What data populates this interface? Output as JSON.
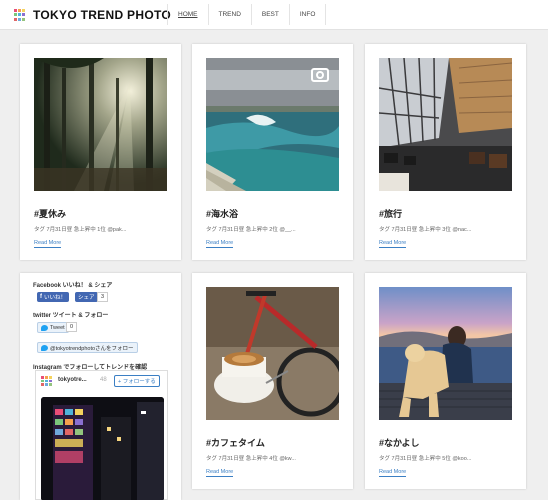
{
  "header": {
    "logo_text": "TOKYO TREND PHOTO",
    "nav": [
      {
        "label": "HOME",
        "active": true
      },
      {
        "label": "TREND",
        "active": false
      },
      {
        "label": "BEST",
        "active": false
      },
      {
        "label": "INFO",
        "active": false
      }
    ]
  },
  "posts": [
    {
      "tag": "#夏休み",
      "meta": "タグ 7月31日昼 急上昇中 1位 @pak...",
      "more": "Read More"
    },
    {
      "tag": "#海水浴",
      "meta": "タグ 7月31日昼 急上昇中 2位 @__...",
      "more": "Read More"
    },
    {
      "tag": "#旅行",
      "meta": "タグ 7月31日昼 急上昇中 3位 @nac...",
      "more": "Read More"
    },
    {
      "tag": "#カフェタイム",
      "meta": "タグ 7月31日昼 急上昇中 4位 @kw...",
      "more": "Read More"
    },
    {
      "tag": "#なかよし",
      "meta": "タグ 7月31日昼 急上昇中 5位 @koo...",
      "more": "Read More"
    }
  ],
  "sidebar": {
    "facebook_label": "Facebook いいね！ & シェア",
    "fb_like": "いいね！",
    "fb_share": "シェア",
    "fb_count": "3",
    "twitter_label": "twitter ツイート & フォロー",
    "tweet": "Tweet",
    "tweet_count": "0",
    "follow_twitter": "@tokyotrendphotoさんをフォロー",
    "instagram_label": "Instagram でフォローしてトレンドを確認",
    "insta_user": "tokyotre...",
    "insta_num": "48",
    "insta_follow": "+ フォローする"
  },
  "colors": {
    "accent_link": "#3b7fc4",
    "facebook": "#4267b2",
    "twitter": "#1da1f2"
  }
}
